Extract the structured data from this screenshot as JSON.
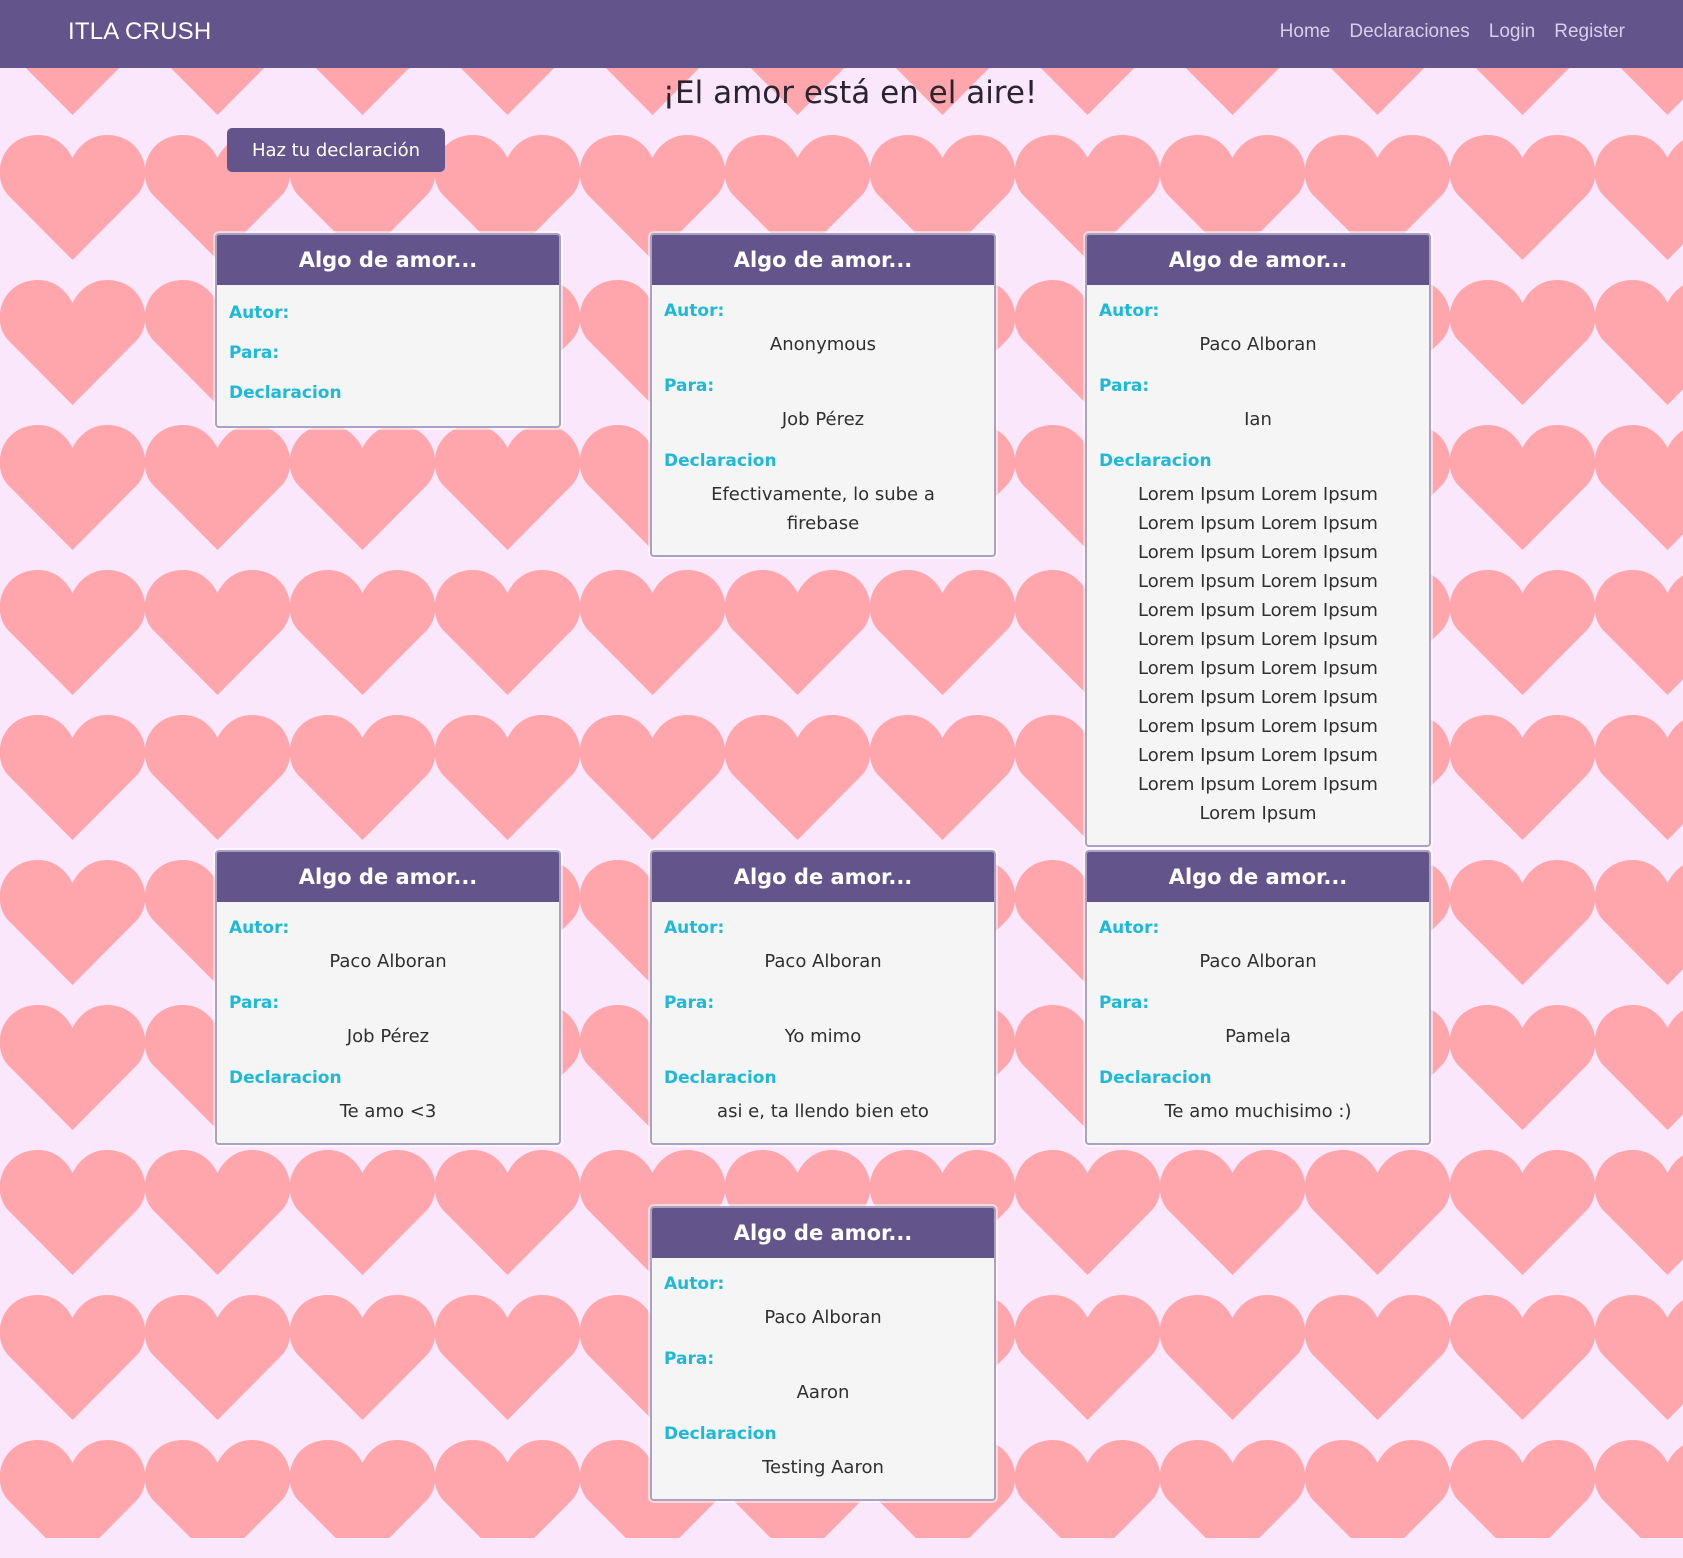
{
  "navbar": {
    "brand": "ITLA CRUSH",
    "links": [
      "Home",
      "Declaraciones",
      "Login",
      "Register"
    ]
  },
  "hero": {
    "title": "¡El amor está en el aire!",
    "button_label": "Haz tu declaración"
  },
  "labels": {
    "card_title": "Algo de amor...",
    "autor": "Autor:",
    "para": "Para:",
    "declaracion": "Declaracion"
  },
  "cards": [
    {
      "title": "Algo de amor...",
      "autor": "",
      "para": "",
      "declaracion": ""
    },
    {
      "title": "Algo de amor...",
      "autor": "Anonymous",
      "para": "Job Pérez",
      "declaracion": "Efectivamente, lo sube a firebase"
    },
    {
      "title": "Algo de amor...",
      "autor": "Paco Alboran",
      "para": "Ian",
      "declaracion": "Lorem Ipsum Lorem Ipsum Lorem Ipsum Lorem Ipsum Lorem Ipsum Lorem Ipsum Lorem Ipsum Lorem Ipsum Lorem Ipsum Lorem Ipsum Lorem Ipsum Lorem Ipsum Lorem Ipsum Lorem Ipsum Lorem Ipsum Lorem Ipsum Lorem Ipsum Lorem Ipsum Lorem Ipsum Lorem Ipsum Lorem Ipsum Lorem Ipsum Lorem Ipsum"
    },
    {
      "title": "Algo de amor...",
      "autor": "Paco Alboran",
      "para": "Job Pérez",
      "declaracion": "Te amo <3"
    },
    {
      "title": "Algo de amor...",
      "autor": "Paco Alboran",
      "para": "Yo mimo",
      "declaracion": "asi e, ta llendo bien eto"
    },
    {
      "title": "Algo de amor...",
      "autor": "Paco Alboran",
      "para": "Pamela",
      "declaracion": "Te amo muchisimo :)"
    },
    {
      "title": "Algo de amor...",
      "autor": "Paco Alboran",
      "para": "Aaron",
      "declaracion": "Testing Aaron"
    }
  ],
  "colors": {
    "navbar": "#63558c",
    "background": "#fbe7fb",
    "heart": "#ffa6ac",
    "label_accent": "#1fb9d8",
    "card_body": "#f5f5f5"
  },
  "icons": {
    "background_pattern": "heart-icon"
  }
}
